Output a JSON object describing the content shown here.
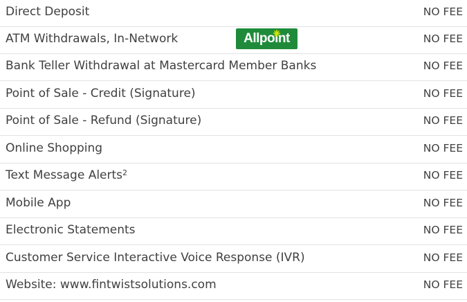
{
  "fees": {
    "rows": [
      {
        "label": "Direct Deposit",
        "fee": "NO FEE"
      },
      {
        "label": "ATM Withdrawals, In-Network",
        "fee": "NO FEE"
      },
      {
        "label": "Bank Teller Withdrawal at Mastercard Member Banks",
        "fee": "NO FEE"
      },
      {
        "label": "Point of Sale - Credit (Signature)",
        "fee": "NO FEE"
      },
      {
        "label": "Point of Sale - Refund (Signature)",
        "fee": "NO FEE"
      },
      {
        "label": "Online Shopping",
        "fee": "NO FEE"
      },
      {
        "label": "Text Message Alerts",
        "superscript": "2",
        "fee": "NO FEE"
      },
      {
        "label": "Mobile App",
        "fee": "NO FEE"
      },
      {
        "label": "Electronic Statements",
        "fee": "NO FEE"
      },
      {
        "label": "Customer Service Interactive Voice Response (IVR)",
        "fee": "NO FEE"
      },
      {
        "label": "Website: www.fintwistsolutions.com",
        "fee": "NO FEE"
      }
    ],
    "logo": {
      "text": "Allpoint",
      "icon": "allpoint-star-icon",
      "background_color": "#1f8b3a",
      "accent_color": "#d4e600"
    }
  }
}
